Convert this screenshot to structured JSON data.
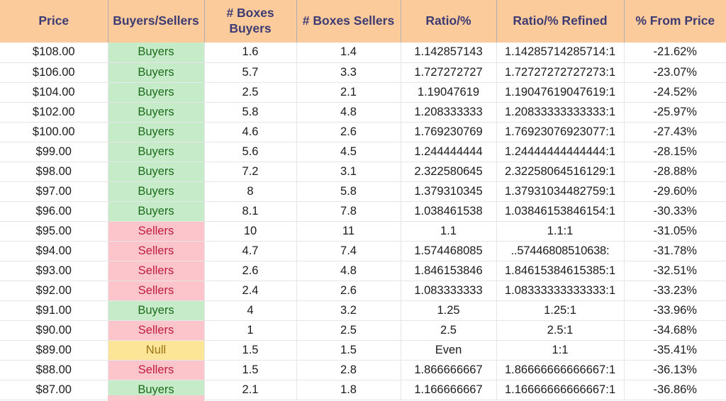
{
  "table": {
    "columns": [
      {
        "key": "price",
        "label": "Price"
      },
      {
        "key": "side",
        "label": "Buyers/Sellers"
      },
      {
        "key": "bb",
        "label": "# Boxes Buyers"
      },
      {
        "key": "bs",
        "label": "# Boxes Sellers"
      },
      {
        "key": "ratio",
        "label": "Ratio/%"
      },
      {
        "key": "ratioref",
        "label": "Ratio/% Refined"
      },
      {
        "key": "pct",
        "label": "% From Price"
      }
    ],
    "rows": [
      {
        "price": "$108.00",
        "side": "Buyers",
        "side_state": "buyers",
        "bb": "1.6",
        "bs": "1.4",
        "ratio": "1.142857143",
        "ratioref": "1.14285714285714:1",
        "pct": "-21.62%"
      },
      {
        "price": "$106.00",
        "side": "Buyers",
        "side_state": "buyers",
        "bb": "5.7",
        "bs": "3.3",
        "ratio": "1.727272727",
        "ratioref": "1.72727272727273:1",
        "pct": "-23.07%"
      },
      {
        "price": "$104.00",
        "side": "Buyers",
        "side_state": "buyers",
        "bb": "2.5",
        "bs": "2.1",
        "ratio": "1.19047619",
        "ratioref": "1.19047619047619:1",
        "pct": "-24.52%"
      },
      {
        "price": "$102.00",
        "side": "Buyers",
        "side_state": "buyers",
        "bb": "5.8",
        "bs": "4.8",
        "ratio": "1.208333333",
        "ratioref": "1.20833333333333:1",
        "pct": "-25.97%"
      },
      {
        "price": "$100.00",
        "side": "Buyers",
        "side_state": "buyers",
        "bb": "4.6",
        "bs": "2.6",
        "ratio": "1.769230769",
        "ratioref": "1.76923076923077:1",
        "pct": "-27.43%"
      },
      {
        "price": "$99.00",
        "side": "Buyers",
        "side_state": "buyers",
        "bb": "5.6",
        "bs": "4.5",
        "ratio": "1.244444444",
        "ratioref": "1.24444444444444:1",
        "pct": "-28.15%"
      },
      {
        "price": "$98.00",
        "side": "Buyers",
        "side_state": "buyers",
        "bb": "7.2",
        "bs": "3.1",
        "ratio": "2.322580645",
        "ratioref": "2.32258064516129:1",
        "pct": "-28.88%"
      },
      {
        "price": "$97.00",
        "side": "Buyers",
        "side_state": "buyers",
        "bb": "8",
        "bs": "5.8",
        "ratio": "1.379310345",
        "ratioref": "1.37931034482759:1",
        "pct": "-29.60%"
      },
      {
        "price": "$96.00",
        "side": "Buyers",
        "side_state": "buyers",
        "bb": "8.1",
        "bs": "7.8",
        "ratio": "1.038461538",
        "ratioref": "1.03846153846154:1",
        "pct": "-30.33%"
      },
      {
        "price": "$95.00",
        "side": "Sellers",
        "side_state": "sellers",
        "bb": "10",
        "bs": "11",
        "ratio": "1.1",
        "ratioref": "1.1:1",
        "pct": "-31.05%"
      },
      {
        "price": "$94.00",
        "side": "Sellers",
        "side_state": "sellers",
        "bb": "4.7",
        "bs": "7.4",
        "ratio": "1.574468085",
        "ratioref": "..57446808510638:",
        "pct": "-31.78%"
      },
      {
        "price": "$93.00",
        "side": "Sellers",
        "side_state": "sellers",
        "bb": "2.6",
        "bs": "4.8",
        "ratio": "1.846153846",
        "ratioref": "1.84615384615385:1",
        "pct": "-32.51%"
      },
      {
        "price": "$92.00",
        "side": "Sellers",
        "side_state": "sellers",
        "bb": "2.4",
        "bs": "2.6",
        "ratio": "1.083333333",
        "ratioref": "1.08333333333333:1",
        "pct": "-33.23%"
      },
      {
        "price": "$91.00",
        "side": "Buyers",
        "side_state": "buyers",
        "bb": "4",
        "bs": "3.2",
        "ratio": "1.25",
        "ratioref": "1.25:1",
        "pct": "-33.96%"
      },
      {
        "price": "$90.00",
        "side": "Sellers",
        "side_state": "sellers",
        "bb": "1",
        "bs": "2.5",
        "ratio": "2.5",
        "ratioref": "2.5:1",
        "pct": "-34.68%"
      },
      {
        "price": "$89.00",
        "side": "Null",
        "side_state": "null",
        "bb": "1.5",
        "bs": "1.5",
        "ratio": "Even",
        "ratioref": "1:1",
        "pct": "-35.41%"
      },
      {
        "price": "$88.00",
        "side": "Sellers",
        "side_state": "sellers",
        "bb": "1.5",
        "bs": "2.8",
        "ratio": "1.866666667",
        "ratioref": "1.86666666666667:1",
        "pct": "-36.13%"
      },
      {
        "price": "$87.00",
        "side": "Buyers",
        "side_state": "buyers",
        "bb": "2.1",
        "bs": "1.8",
        "ratio": "1.166666667",
        "ratioref": "1.16666666666667:1",
        "pct": "-36.86%"
      }
    ]
  },
  "colors": {
    "header_bg": "#fccb9c",
    "header_text": "#3e3b72",
    "buyers_bg": "#c6ebc9",
    "buyers_text": "#1b6b1b",
    "sellers_bg": "#fbc5cb",
    "sellers_text": "#c01b3e",
    "null_bg": "#fce596",
    "null_text": "#9a7415",
    "grid_line": "#e6e6e6",
    "body_text": "#1b1b1b"
  }
}
